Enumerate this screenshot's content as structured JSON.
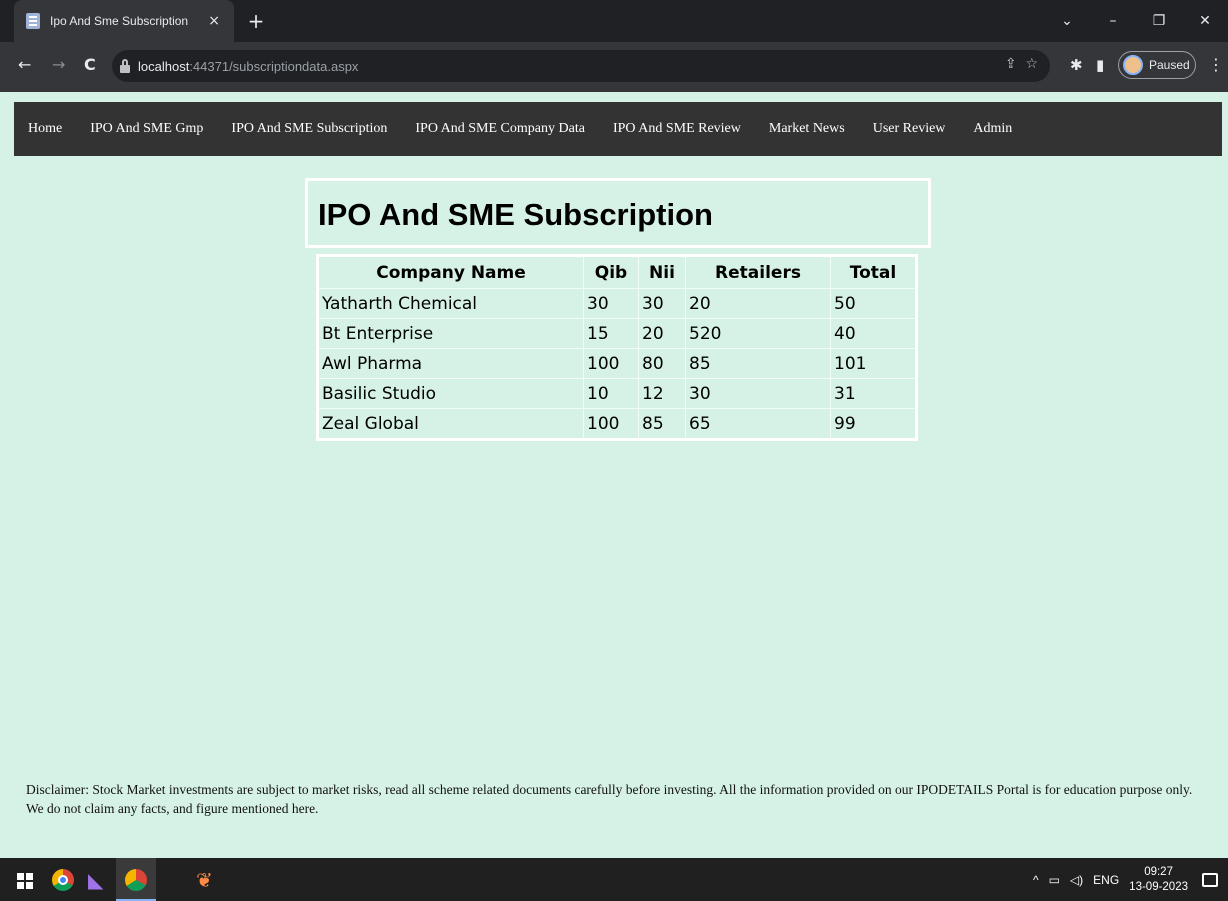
{
  "browser": {
    "tab_title": "Ipo And Sme Subscription",
    "tab_close": "×",
    "new_tab": "+",
    "url_host": "localhost",
    "url_rest": ":44371/subscriptiondata.aspx",
    "profile_status": "Paused",
    "window_controls": [
      "⌄",
      "–",
      "❐",
      "✕"
    ]
  },
  "nav": {
    "items": [
      {
        "label": "Home"
      },
      {
        "label": "IPO And SME Gmp"
      },
      {
        "label": "IPO And SME Subscription"
      },
      {
        "label": "IPO And SME Company Data"
      },
      {
        "label": "IPO And SME Review"
      },
      {
        "label": "Market News"
      },
      {
        "label": "User Review"
      },
      {
        "label": "Admin"
      }
    ]
  },
  "page": {
    "title": "IPO And SME Subscription"
  },
  "table": {
    "headers": [
      "Company Name",
      "Qib",
      "Nii",
      "Retailers",
      "Total"
    ],
    "rows": [
      [
        "Yatharth Chemical",
        "30",
        "30",
        "20",
        "50"
      ],
      [
        "Bt Enterprise",
        "15",
        "20",
        "520",
        "40"
      ],
      [
        "Awl Pharma",
        "100",
        "80",
        "85",
        "101"
      ],
      [
        "Basilic Studio",
        "10",
        "12",
        "30",
        "31"
      ],
      [
        "Zeal Global",
        "100",
        "85",
        "65",
        "99"
      ]
    ]
  },
  "footer": {
    "disclaimer": "Disclaimer: Stock Market investments are subject to market risks, read all scheme related documents carefully before investing. All the information provided on our IPODETAILS Portal is for education purpose only. We do not claim any facts, and figure mentioned here."
  },
  "taskbar": {
    "tray_chevron": "^",
    "language": "ENG",
    "time": "09:27",
    "date": "13-09-2023"
  },
  "colors": {
    "page_background": "#d6f2e6",
    "nav_background": "#333333"
  }
}
